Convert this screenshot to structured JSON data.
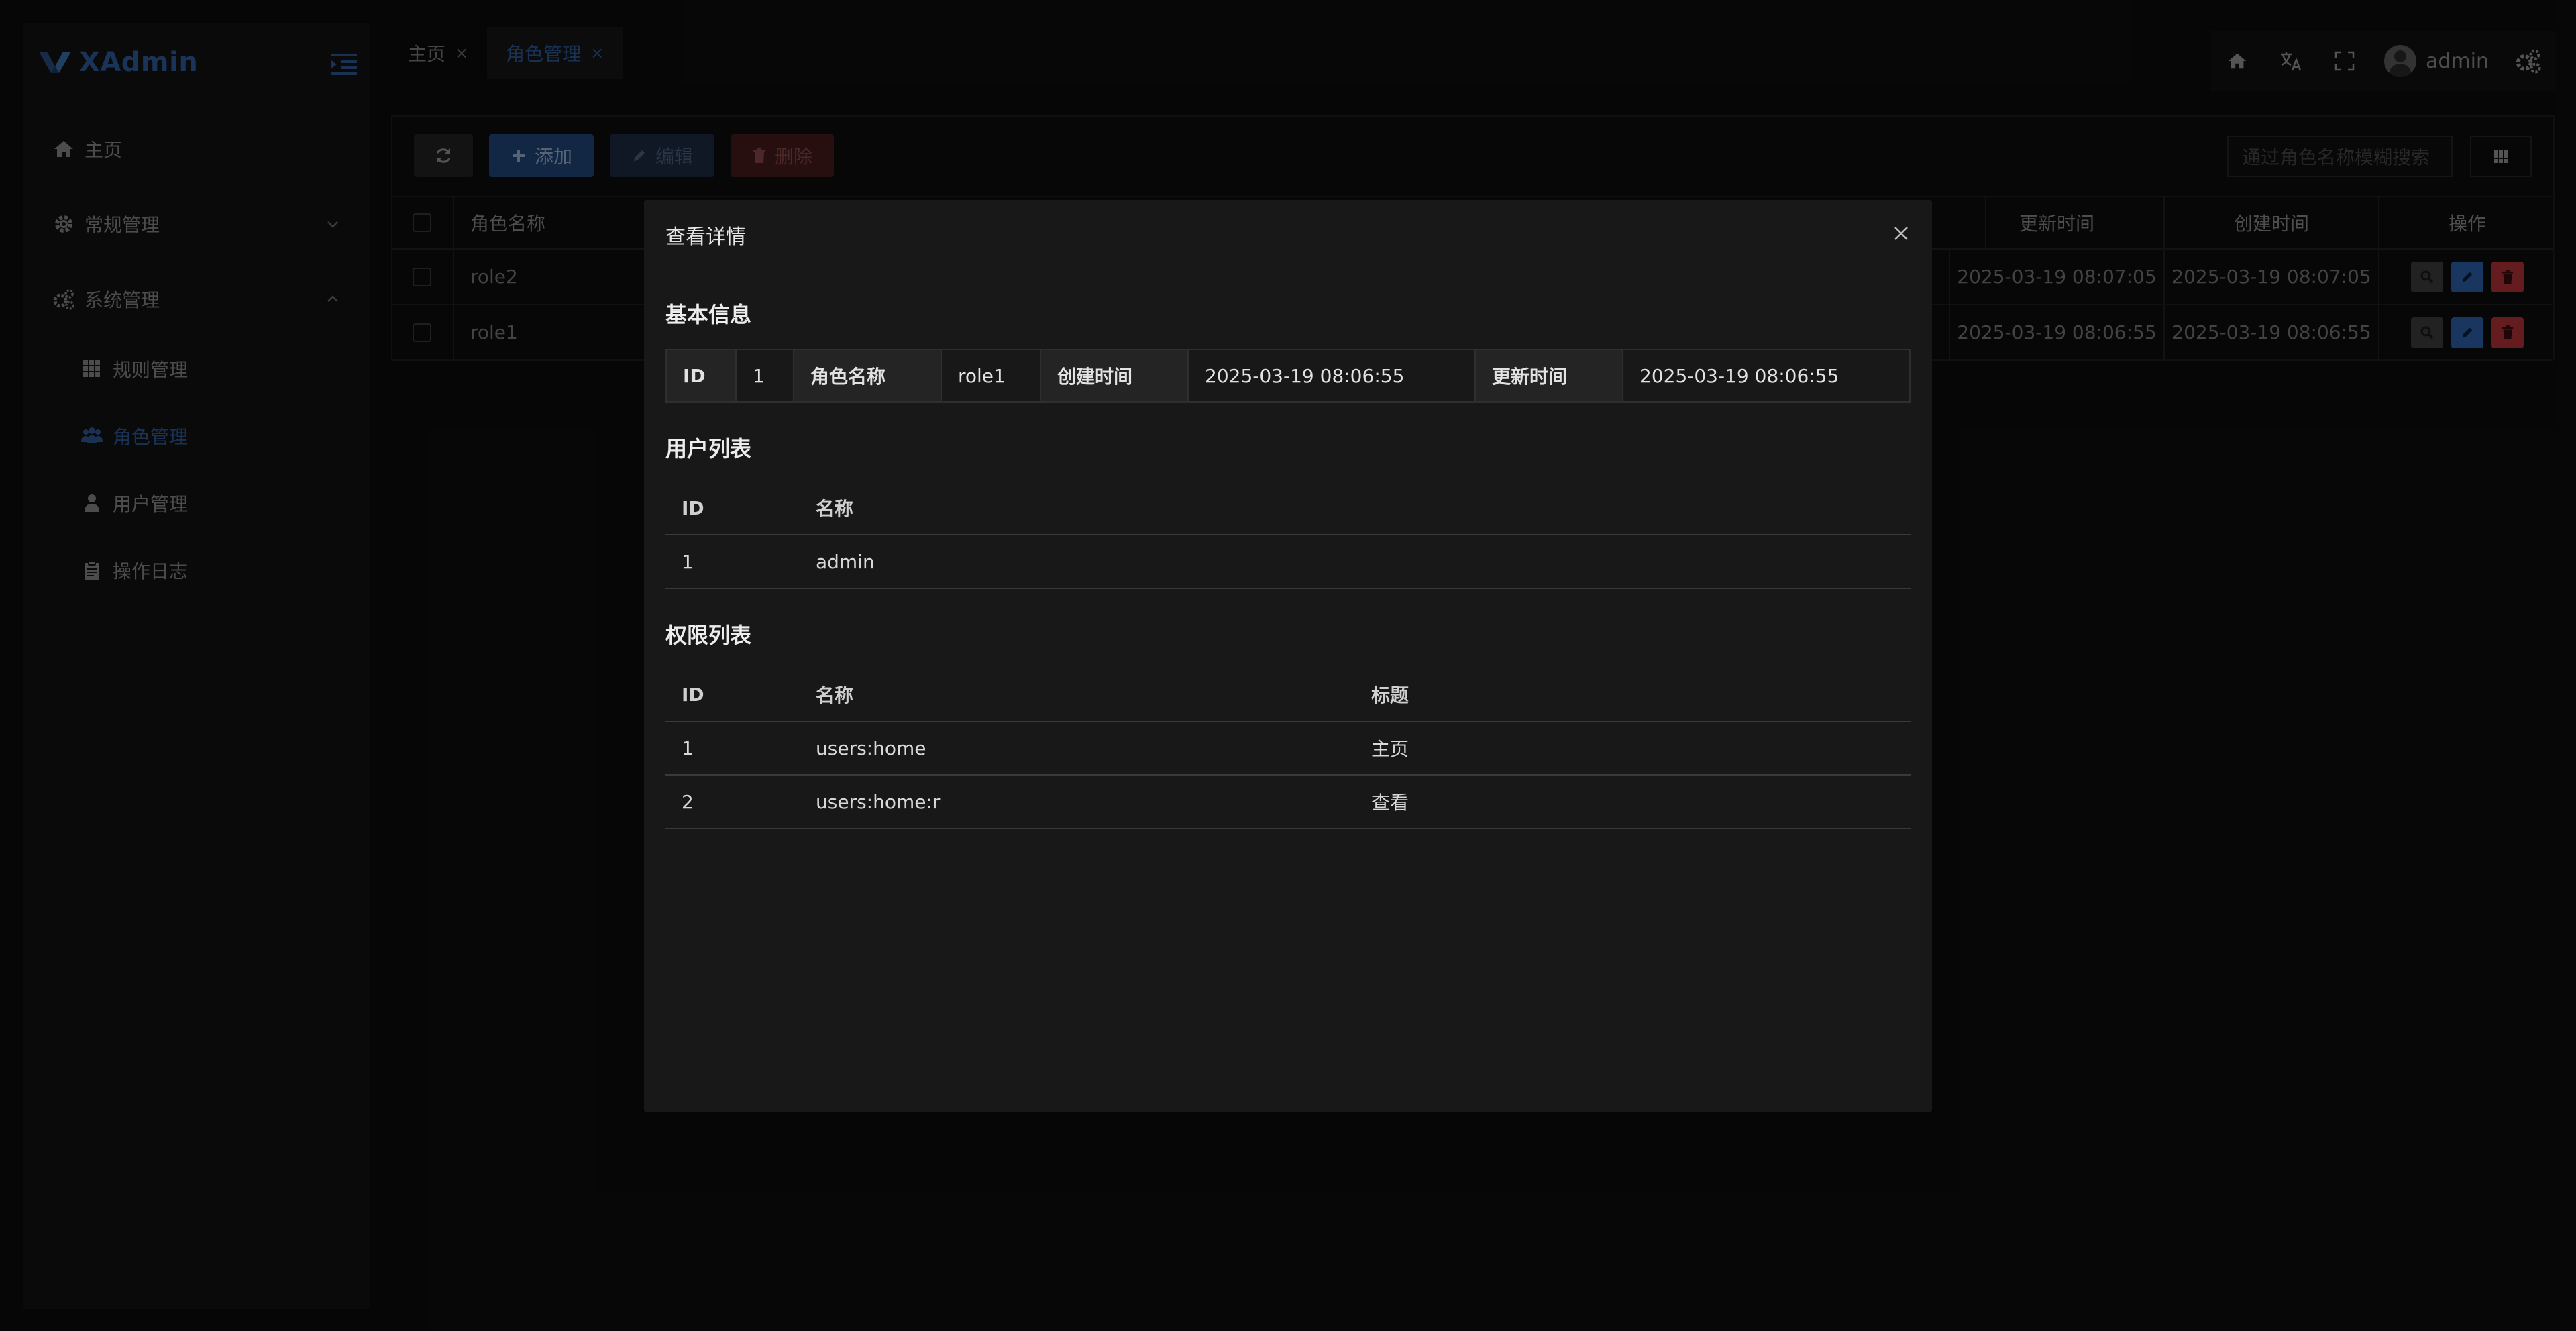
{
  "brand": {
    "name": "XAdmin"
  },
  "sidebar": {
    "items": [
      {
        "label": "主页"
      },
      {
        "label": "常规管理"
      },
      {
        "label": "系统管理"
      },
      {
        "label": "规则管理"
      },
      {
        "label": "角色管理"
      },
      {
        "label": "用户管理"
      },
      {
        "label": "操作日志"
      }
    ]
  },
  "tabs": [
    {
      "label": "主页",
      "close": "×"
    },
    {
      "label": "角色管理",
      "close": "×"
    }
  ],
  "header": {
    "username": "admin"
  },
  "toolbar": {
    "add_label": "添加",
    "edit_label": "编辑",
    "delete_label": "删除",
    "search_placeholder": "通过角色名称模糊搜索"
  },
  "table": {
    "columns": {
      "role_name": "角色名称",
      "updated": "更新时间",
      "created": "创建时间",
      "actions": "操作"
    },
    "rows": [
      {
        "role_name": "role2",
        "updated": "2025-03-19 08:07:05",
        "created": "2025-03-19 08:07:05"
      },
      {
        "role_name": "role1",
        "updated": "2025-03-19 08:06:55",
        "created": "2025-03-19 08:06:55"
      }
    ]
  },
  "modal": {
    "title": "查看详情",
    "basic_title": "基本信息",
    "basic": {
      "id_label": "ID",
      "id_value": "1",
      "name_label": "角色名称",
      "name_value": "role1",
      "created_label": "创建时间",
      "created_value": "2025-03-19 08:06:55",
      "updated_label": "更新时间",
      "updated_value": "2025-03-19 08:06:55"
    },
    "users_title": "用户列表",
    "users": {
      "headers": {
        "id": "ID",
        "name": "名称"
      },
      "rows": [
        {
          "id": "1",
          "name": "admin"
        }
      ]
    },
    "perms_title": "权限列表",
    "perms": {
      "headers": {
        "id": "ID",
        "name": "名称",
        "title": "标题"
      },
      "rows": [
        {
          "id": "1",
          "name": "users:home",
          "title": "主页"
        },
        {
          "id": "2",
          "name": "users:home:r",
          "title": "查看"
        }
      ]
    }
  },
  "colors": {
    "accent": "#2e5b99",
    "primary_button": "#21477a",
    "danger": "#b7343a",
    "modal_bg": "#181818"
  }
}
